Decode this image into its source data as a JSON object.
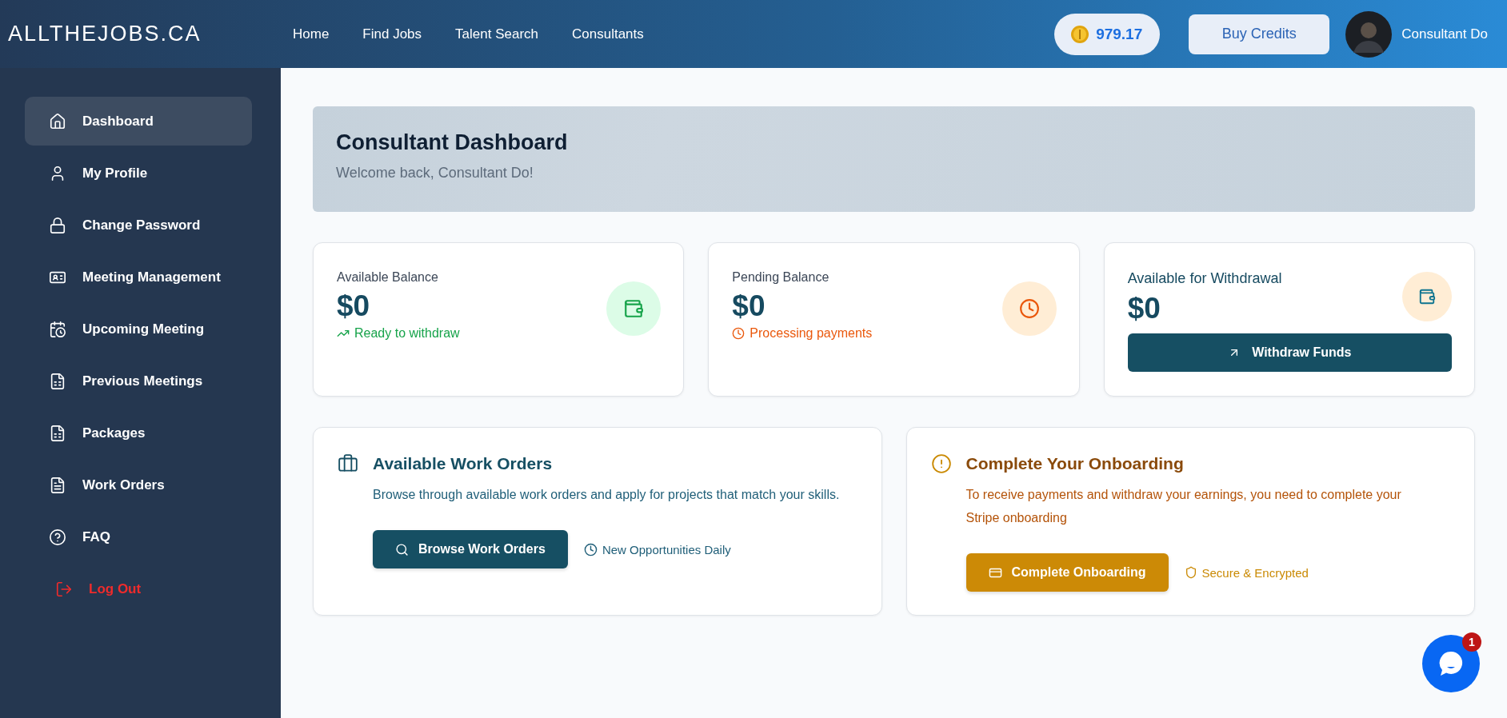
{
  "header": {
    "logo": "ALLTHEJOBS.CA",
    "nav": [
      {
        "label": "Home"
      },
      {
        "label": "Find Jobs"
      },
      {
        "label": "Talent Search"
      },
      {
        "label": "Consultants"
      }
    ],
    "credits": "979.17",
    "buy_button": "Buy Credits",
    "user_name": "Consultant Do"
  },
  "sidebar": {
    "items": [
      {
        "label": "Dashboard",
        "selected": true,
        "kind": "nav"
      },
      {
        "label": "My Profile",
        "selected": false,
        "kind": "nav"
      },
      {
        "label": "Change Password",
        "selected": false,
        "kind": "nav"
      },
      {
        "label": "Meeting Management",
        "selected": false,
        "kind": "nav"
      },
      {
        "label": "Upcoming Meeting",
        "selected": false,
        "kind": "nav"
      },
      {
        "label": "Previous Meetings",
        "selected": false,
        "kind": "nav"
      },
      {
        "label": "Packages",
        "selected": false,
        "kind": "nav"
      },
      {
        "label": "Work Orders",
        "selected": false,
        "kind": "nav"
      },
      {
        "label": "FAQ",
        "selected": false,
        "kind": "nav"
      },
      {
        "label": "Log Out",
        "selected": false,
        "kind": "logout"
      }
    ]
  },
  "banner": {
    "title": "Consultant Dashboard",
    "subtitle": "Welcome back, Consultant Do!"
  },
  "stats": [
    {
      "label": "Available Balance",
      "value": "$0",
      "note": "Ready to withdraw",
      "kind": "note",
      "color": "#16a34a"
    },
    {
      "label": "Pending Balance",
      "value": "$0",
      "note": "Processing payments",
      "kind": "note",
      "color": "#ea580c"
    },
    {
      "label": "Available for Withdrawal",
      "value": "$0",
      "button": "Withdraw Funds",
      "kind": "action",
      "color": "#0e7490"
    }
  ],
  "panels": [
    {
      "title": "Available Work Orders",
      "text": "Browse through available work orders and apply for projects that match your skills.",
      "button": "Browse Work Orders",
      "note": "New Opportunities Daily",
      "kind": "work"
    },
    {
      "title": "Complete Your Onboarding",
      "text": "To receive payments and withdraw your earnings, you need to complete your Stripe onboarding",
      "button": "Complete Onboarding",
      "note": "Secure & Encrypted",
      "kind": "onboarding"
    }
  ],
  "chat": {
    "badge": "1"
  }
}
